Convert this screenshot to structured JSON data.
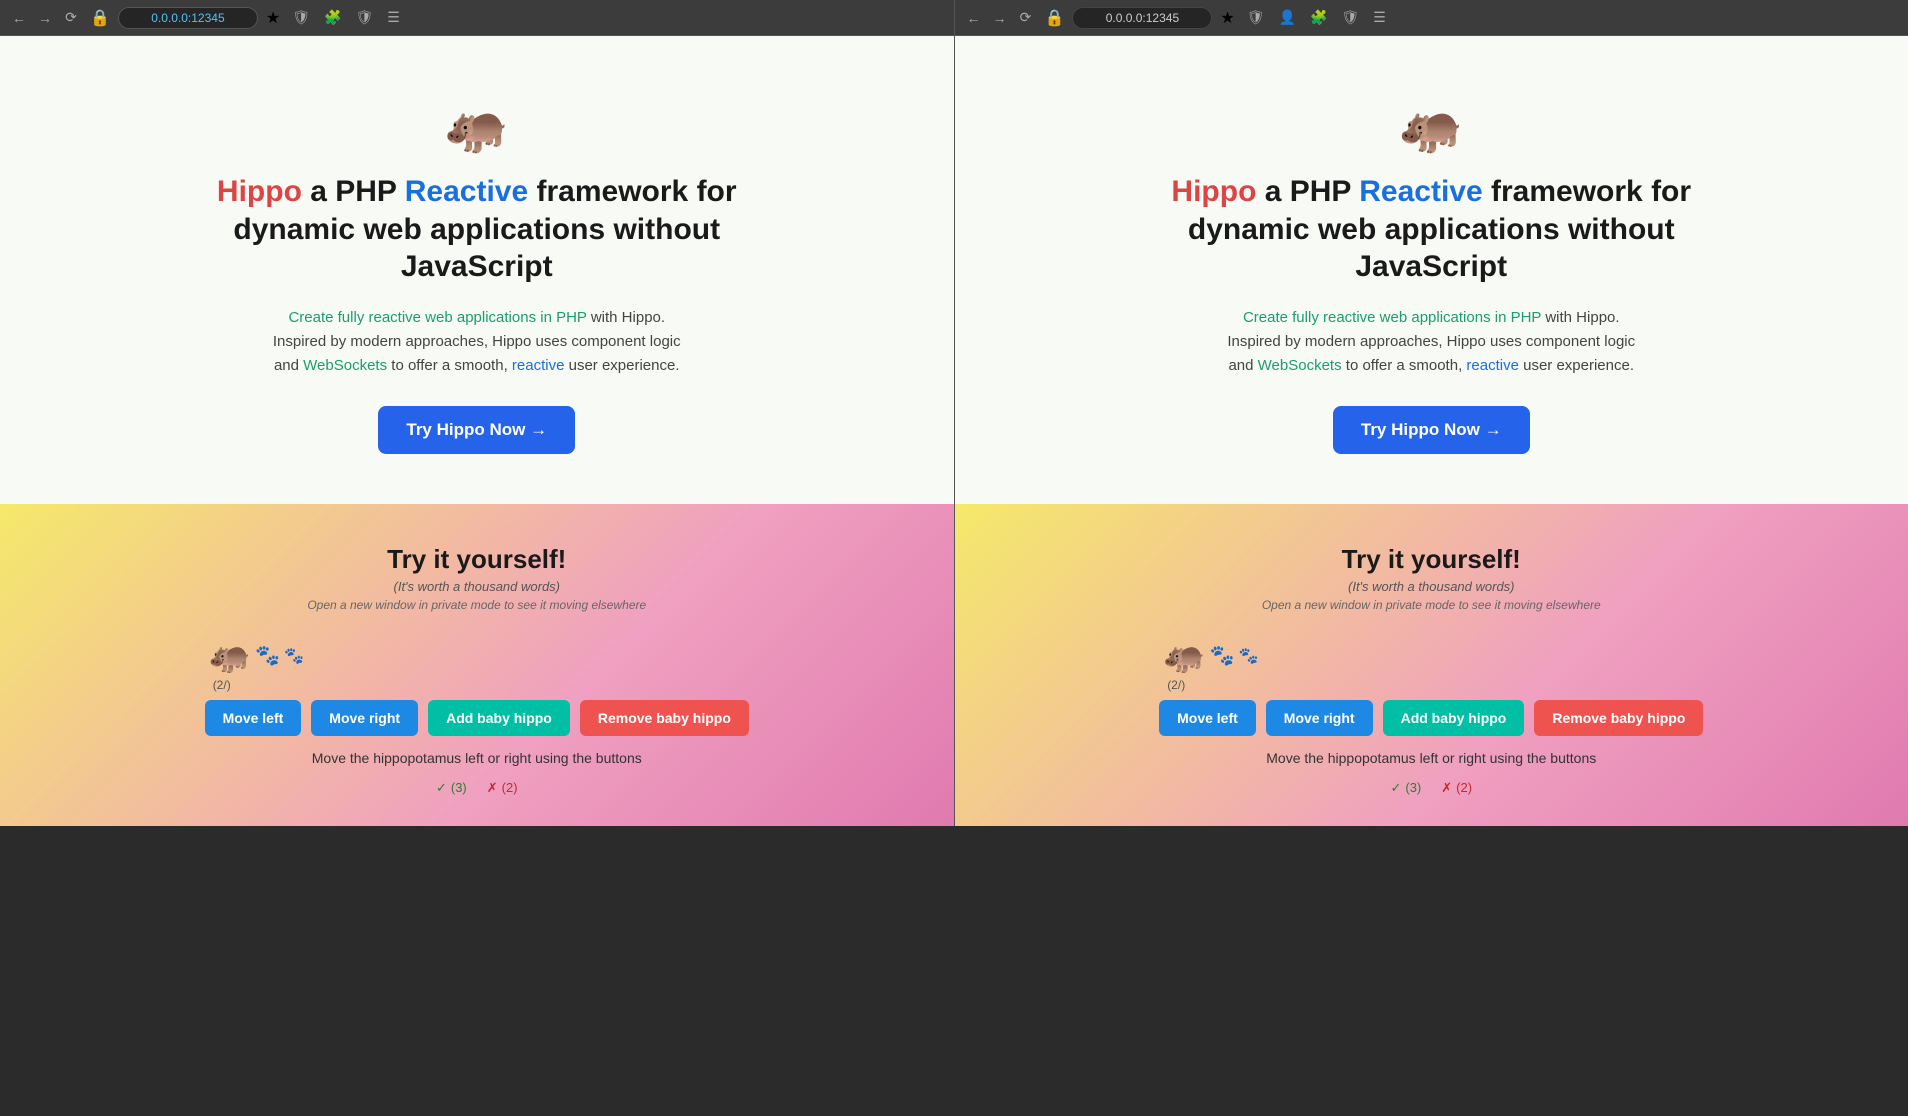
{
  "browser": {
    "left": {
      "url": "0.0.0.0:12345",
      "url_highlighted": true
    },
    "right": {
      "url": "0.0.0.0:12345"
    }
  },
  "hero": {
    "hippo_emoji": "🦛",
    "title_part1": "Hippo",
    "title_part2": " a PHP ",
    "title_part3": "Reactive",
    "title_part4": " framework for dynamic web applications without JavaScript",
    "desc_link1": "Create fully reactive web applications in PHP",
    "desc_middle": " with Hippo. Inspired by modern approaches, Hippo uses component logic and ",
    "desc_link2": "WebSockets",
    "desc_end1": " to offer a smooth, ",
    "desc_link3": "reactive",
    "desc_end2": " user experience.",
    "cta_label": "Try Hippo Now →"
  },
  "demo": {
    "title": "Try it yourself!",
    "subtitle": "(It's worth a thousand words)",
    "hint": "Open a new window in private mode to see it moving elsewhere",
    "hippo_emoji": "🦛",
    "baby_emoji": "🐾",
    "counter": "(2/)",
    "btn_move_left": "Move left",
    "btn_move_right": "Move right",
    "btn_add": "Add baby hippo",
    "btn_remove": "Remove baby hippo",
    "description": "Move the hippopotamus left or right using the buttons",
    "stat_ok_count": "(3)",
    "stat_err_count": "(2)"
  }
}
